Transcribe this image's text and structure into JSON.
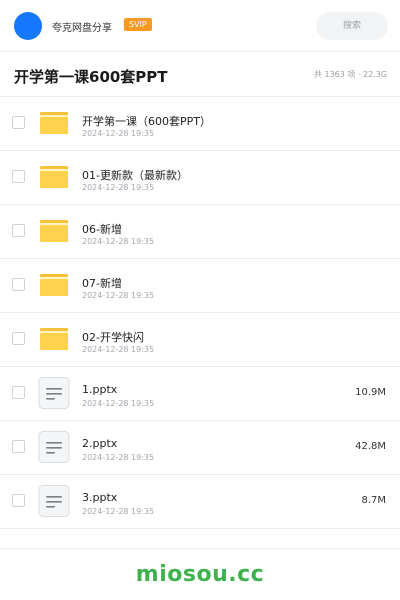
{
  "header": {
    "app_name": "夸克网盘分享",
    "vip_label": "SVIP",
    "search_placeholder": "搜索"
  },
  "title_bar": {
    "title": "开学第一课600套PPT",
    "meta": "共 1363 项 · 22.3G"
  },
  "files": [
    {
      "type": "folder",
      "name": "开学第一课（600套PPT）",
      "date": "2024-12-28 19:35",
      "size": ""
    },
    {
      "type": "folder",
      "name": "01-更新款（最新款）",
      "date": "2024-12-28 19:35",
      "size": ""
    },
    {
      "type": "folder",
      "name": "06-新增",
      "date": "2024-12-28 19:35",
      "size": ""
    },
    {
      "type": "folder",
      "name": "07-新增",
      "date": "2024-12-28 19:35",
      "size": ""
    },
    {
      "type": "folder",
      "name": "02-开学快闪",
      "date": "2024-12-28 19:35",
      "size": ""
    },
    {
      "type": "file",
      "name": "1.pptx",
      "date": "2024-12-28 19:35",
      "size": "10.9M"
    },
    {
      "type": "file",
      "name": "2.pptx",
      "date": "2024-12-28 19:35",
      "size": "42.8M"
    },
    {
      "type": "file",
      "name": "3.pptx",
      "date": "2024-12-28 19:35",
      "size": "8.7M"
    }
  ],
  "watermark": "miosou.cc",
  "colors": {
    "avatar": "#1677ff",
    "vip": "#f59a23",
    "folder_back": "#f7c23b",
    "folder_front": "#ffd24d",
    "watermark": "#3fb24f"
  },
  "icons": {
    "folder": "folder-icon",
    "file": "document-icon"
  }
}
